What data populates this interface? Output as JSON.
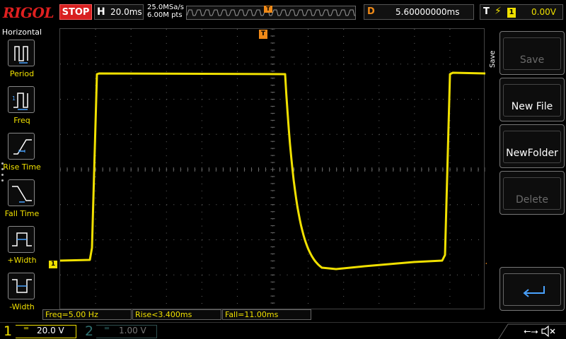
{
  "brand": "RIGOL",
  "header": {
    "run_state": "STOP",
    "timebase_label": "H",
    "timebase_value": "20.0ms",
    "sample_rate": "25.0MSa/s",
    "memory_depth": "6.00M pts",
    "trigger_pos_marker": "T",
    "delay_label": "D",
    "delay_value": "5.60000000ms",
    "trigger_label": "T",
    "trigger_edge_icon": "rising-edge-icon",
    "trigger_source": "1",
    "trigger_level": "0.00V"
  },
  "left_menu": {
    "title": "Horizontal",
    "items": [
      {
        "label": "Period",
        "icon": "period-icon"
      },
      {
        "label": "Freq",
        "icon": "frequency-icon"
      },
      {
        "label": "Rise Time",
        "icon": "rise-time-icon"
      },
      {
        "label": "Fall Time",
        "icon": "fall-time-icon"
      },
      {
        "label": "+Width",
        "icon": "positive-width-icon"
      },
      {
        "label": "-Width",
        "icon": "negative-width-icon"
      }
    ]
  },
  "screen": {
    "channel_marker": "1",
    "trigger_marker": "T",
    "trace_color": "#f0e000",
    "trigger_color": "#f08a18"
  },
  "measurements": [
    {
      "text": "Freq=5.00 Hz"
    },
    {
      "text": "Rise<3.400ms"
    },
    {
      "text": "Fall=11.00ms"
    }
  ],
  "right_menu": {
    "title": "Save",
    "buttons": [
      {
        "label": "Save",
        "enabled": false
      },
      {
        "label": "New File",
        "enabled": true
      },
      {
        "label": "NewFolder",
        "enabled": true
      },
      {
        "label": "Delete",
        "enabled": false
      },
      {
        "label": "",
        "icon": "return-arrow-icon",
        "enabled": true
      }
    ]
  },
  "channels": {
    "ch1": {
      "number": "1",
      "scale": "20.0 V",
      "color": "#f0e000"
    },
    "ch2": {
      "number": "2",
      "scale": "1.00 V",
      "color": "#2f6f6f"
    }
  },
  "status_icons": [
    "usb-icon",
    "mute-icon"
  ]
}
